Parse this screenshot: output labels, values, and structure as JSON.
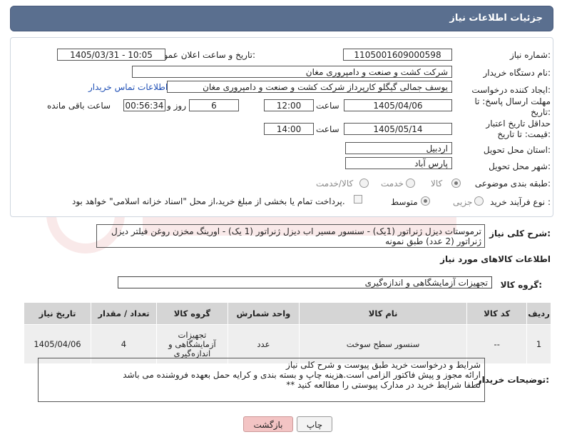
{
  "header": {
    "title": "جزئیات اطلاعات نیاز"
  },
  "fields": {
    "need_number_label": "شماره نیاز:",
    "need_number": "1105001609000598",
    "announce_label": "تاریخ و ساعت اعلان عمومی:",
    "announce_value": "1405/03/31 - 10:05",
    "buyer_org_label": "نام دستگاه خریدار:",
    "buyer_org": "شرکت کشت و صنعت و دامپروری مغان",
    "creator_label": "ایجاد کننده درخواست:",
    "creator": "یوسف جمالی گیگلو کارپرداز شرکت کشت و صنعت و دامپروری مغان",
    "contact_link": "اطلاعات تماس خریدار",
    "reply_deadline_label": "مهلت ارسال پاسخ: تا تاریخ:",
    "reply_date": "1405/04/06",
    "time_label": "ساعت",
    "reply_time": "12:00",
    "days_value": "6",
    "days_label": "روز و",
    "remaining_value": "00:56:34",
    "remaining_label": "ساعت باقی مانده",
    "price_validity_label": "حداقل تاریخ اعتبار قیمت: تا تاریخ:",
    "price_date": "1405/05/14",
    "price_time": "14:00",
    "province_label": "استان محل تحویل:",
    "province": "اردبیل",
    "city_label": "شهر محل تحویل:",
    "city": "پارس آباد",
    "category_label": "طبقه بندی موضوعی:",
    "category_options": [
      "کالا",
      "خدمت",
      "کالا/خدمت"
    ],
    "process_label": "نوع فرآیند خرید :",
    "process_options": [
      "جزیی",
      "متوسط"
    ],
    "payment_note": "پرداخت تمام یا بخشی از مبلغ خرید،از محل \"اسناد خزانه اسلامی\" خواهد بود."
  },
  "description": {
    "label": "شرح کلی نیاز:",
    "text": "ترموستات دیزل ژنراتور (1یک) - سنسور مسیر اب دیزل ژنراتور (1 یک) - اورینگ مخزن روغن فیلتر دیزل ژنراتور (2 عدد) طبق نمونه"
  },
  "goods": {
    "section_title": "اطلاعات کالاهای مورد نیاز",
    "group_label": "گروه کالا:",
    "group_value": "تجهیزات آزمایشگاهی و اندازه‌گیری",
    "columns": [
      "ردیف",
      "کد کالا",
      "نام کالا",
      "واحد شمارش",
      "گروه کالا",
      "تعداد / مقدار",
      "تاریخ نیاز"
    ],
    "rows": [
      {
        "row": "1",
        "code": "--",
        "name": "سنسور سطح سوخت",
        "unit": "عدد",
        "group_lines": [
          "تجهیزات",
          "آزمایشگاهی و",
          "اندازه‌گیری"
        ],
        "qty": "4",
        "date": "1405/04/06"
      }
    ]
  },
  "notes": {
    "label": "توضیحات خریدار:",
    "lines": [
      "شرایط و درخواست خرید طبق پیوست و شرح کلی نیاز",
      "ارائه مجوز و پیش فاکتور الزامی است.هزینه چاپ و بسته بندی و کرایه حمل بعهده فروشنده می باشد",
      "لطفا شرایط خرید در مدارک پیوستی را مطالعه کنید **"
    ]
  },
  "buttons": {
    "print": "چاپ",
    "back": "بازگشت"
  },
  "colors": {
    "header_bg": "#5a6f8f",
    "table_header": "#d5d5d5",
    "table_row": "#eeeeee",
    "back_button": "#f3c4c4"
  }
}
